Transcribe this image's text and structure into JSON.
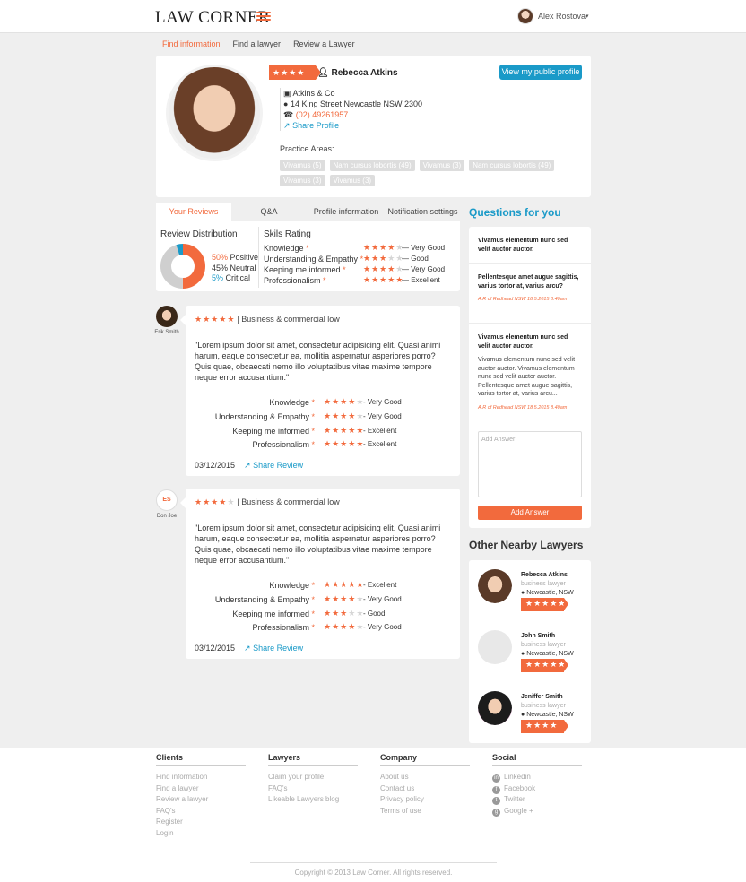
{
  "header": {
    "logo": "LAW CORNER",
    "user_name": "Alex Rostova",
    "user_caret": "▾"
  },
  "nav": [
    {
      "label": "Find information"
    },
    {
      "label": "Find a lawyer"
    },
    {
      "label": "Review a Lawyer"
    }
  ],
  "profile": {
    "rating_stars": 4,
    "name": "Rebecca Atkins",
    "public_button": "View my public profile",
    "firm": "Atkins & Co",
    "address": "14 King Street Newcastle NSW 2300",
    "phone": "(02) 49261957",
    "share": "Share Profile",
    "practice_label": "Practice Areas:",
    "practice_tags": [
      "Vivamus (5)",
      "Nam cursus lobortis (49)",
      "Vivamus (3)",
      "Nam cursus lobortis (49)",
      "Vivamus (3)",
      "Vivamus (3)"
    ]
  },
  "tabs": [
    {
      "label": "Your Reviews"
    },
    {
      "label": "Q&A"
    },
    {
      "label": "Profile information"
    },
    {
      "label": "Notification settings"
    }
  ],
  "distribution": {
    "title": "Review Distribution",
    "positive_pct": "50%",
    "positive_label": "Positive",
    "neutral_pct": "45%",
    "neutral_label": "Neutral",
    "critical_pct": "5%",
    "critical_label": "Critical",
    "values": {
      "positive": 50,
      "neutral": 45,
      "critical": 5
    }
  },
  "skills": {
    "title": "Skils Rating",
    "rows": [
      {
        "label": "Knowledge",
        "stars": 4,
        "text": "— Very Good"
      },
      {
        "label": "Understanding & Empathy",
        "stars": 3,
        "text": "— Good"
      },
      {
        "label": "Keeping me informed",
        "stars": 4,
        "text": "— Very Good"
      },
      {
        "label": "Professionalism",
        "stars": 5,
        "text": "— Excellent"
      }
    ]
  },
  "reviews": [
    {
      "reviewer": "Erik Smith",
      "initials": "",
      "stars": 5,
      "category": "| Business & commercial low",
      "quote": "\"Lorem ipsum dolor sit amet, consectetur adipisicing elit. Quasi animi harum, eaque consectetur ea, mollitia aspernatur asperiores porro? Quis quae, obcaecati nemo illo voluptatibus vitae maxime tempore neque error accusantium.\"",
      "skills": [
        {
          "label": "Knowledge",
          "stars": 4,
          "text": "- Very Good"
        },
        {
          "label": "Understanding & Empathy",
          "stars": 4,
          "text": "- Very Good"
        },
        {
          "label": "Keeping me informed",
          "stars": 5,
          "text": "- Excellent"
        },
        {
          "label": "Professionalism",
          "stars": 5,
          "text": "- Excellent"
        }
      ],
      "date": "03/12/2015",
      "share": "Share Review"
    },
    {
      "reviewer": "Don Joe",
      "initials": "ES",
      "stars": 4,
      "category": "| Business & commercial low",
      "quote": "\"Lorem ipsum dolor sit amet, consectetur adipisicing elit. Quasi animi harum, eaque consectetur ea, mollitia aspernatur asperiores porro? Quis quae, obcaecati nemo illo voluptatibus vitae maxime tempore neque error accusantium.\"",
      "skills": [
        {
          "label": "Knowledge",
          "stars": 5,
          "text": "- Excellent"
        },
        {
          "label": "Understanding & Empathy",
          "stars": 4,
          "text": "- Very Good"
        },
        {
          "label": "Keeping me informed",
          "stars": 3,
          "text": "- Good"
        },
        {
          "label": "Professionalism",
          "stars": 4,
          "text": "- Very Good"
        }
      ],
      "date": "03/12/2015",
      "share": "Share Review"
    }
  ],
  "questions": {
    "title": "Questions for you",
    "items": [
      {
        "title": "Vivamus elementum nunc sed velit auctor auctor.",
        "body": "",
        "meta": ""
      },
      {
        "title": "Pellentesque amet augue sagittis, varius tortor at, varius arcu?",
        "body": "",
        "meta": "A.R of Redhead NSW 18.5.2015 8.40am"
      },
      {
        "title": "Vivamus elementum nunc sed velit auctor auctor.",
        "body": "Vivamus elementum nunc sed velit auctor auctor. Vivamus elementum nunc sed velit auctor auctor. Pellentesque amet augue sagittis, varius tortor at, varius arcu...",
        "meta": "A.R of Redhead NSW 18.5.2015 8.40am"
      }
    ],
    "answer_placeholder": "Add Answer",
    "answer_button": "Add Answer"
  },
  "nearby": {
    "title": "Other Nearby Lawyers",
    "lawyers": [
      {
        "name": "Rebecca Atkins",
        "type": "business lawyer",
        "location": "Newcastle, NSW",
        "stars": 5
      },
      {
        "name": "John Smith",
        "type": "business lawyer",
        "location": "Newcastle, NSW",
        "stars": 4.5
      },
      {
        "name": "Jeniffer Smith",
        "type": "business lawyer",
        "location": "Newcastle, NSW",
        "stars": 4
      }
    ]
  },
  "footer": {
    "clients": {
      "title": "Clients",
      "links": [
        "Find information",
        "Find a lawyer",
        "Review a lawyer",
        "FAQ's",
        "Register",
        "Login"
      ]
    },
    "lawyers": {
      "title": "Lawyers",
      "links": [
        "Claim your profile",
        "FAQ's",
        "Likeable Lawyers blog"
      ]
    },
    "company": {
      "title": "Company",
      "links": [
        "About us",
        "Contact us",
        "Privacy policy",
        "Terms of use"
      ]
    },
    "social": {
      "title": "Social",
      "links": [
        "Linkedin",
        "Facebook",
        "Twitter",
        "Google +"
      ]
    },
    "copyright": "Copyright © 2013 Law Corner. All rights reserved."
  },
  "colors": {
    "accent": "#f26a3d",
    "link": "#1a9ac8",
    "neutral_segment": "#cfcfcf"
  }
}
